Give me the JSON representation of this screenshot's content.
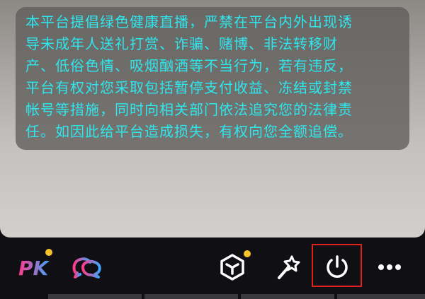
{
  "notice": {
    "text": "本平台提倡绿色健康直播，严禁在平台内外出现诱\n导未成年人送礼打赏、诈骗、赌博、非法转移财\n产、低俗色情、吸烟酗酒等不当行为，若有违反，\n平台有权对您采取包括暂停支付收益、冻结或封禁\n帐号等措施，同时向相关部门依法追究您的法律责\n任。如因此给平台造成损失，有权向您全额追偿。",
    "text_color": "#2fe6ee"
  },
  "toolbar": {
    "pk_label": "PK",
    "items": [
      {
        "icon": "pk-icon",
        "has_badge": true
      },
      {
        "icon": "chat-bubbles-icon",
        "has_badge": false
      },
      {
        "icon": "hexagon-box-icon",
        "has_badge": true
      },
      {
        "icon": "magic-wand-icon",
        "has_badge": false
      },
      {
        "icon": "power-icon",
        "highlighted": true
      },
      {
        "icon": "more-icon",
        "has_badge": false
      }
    ],
    "badge_color": "#f6c32b",
    "highlight_color": "#e0201c"
  }
}
